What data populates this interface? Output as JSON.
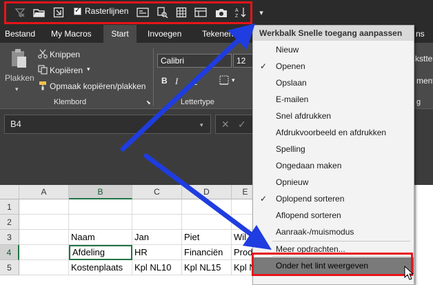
{
  "qat": {
    "rasterlijnen_label": "Rasterlijnen",
    "more_glyph": "▾",
    "icons": [
      "clear-filter-icon",
      "open-folder-icon",
      "grid-icon",
      "rasterlijnen-checkbox",
      "form-icon",
      "print-preview-icon",
      "table-icon",
      "table2-icon",
      "camera-icon",
      "sort-az-icon",
      "customize-icon"
    ]
  },
  "tabs": [
    "Bestand",
    "My Macros",
    "Start",
    "Invoegen",
    "Tekenen",
    "ns"
  ],
  "ribbon": {
    "paste_label": "Plakken",
    "cut_label": "Knippen",
    "copy_label": "Kopiëren",
    "format_painter_label": "Opmaak kopiëren/plakken",
    "clipboard_group": "Klembord",
    "font_name": "Calibri",
    "font_size": "12",
    "font_group": "Lettertype",
    "bold": "B",
    "italic": "I",
    "right_cut_1": "ksttер",
    "right_cut_2": "menv",
    "right_cut_3": "g"
  },
  "namebox": {
    "value": "B4"
  },
  "grid": {
    "columns": [
      "A",
      "B",
      "C",
      "D",
      "E"
    ],
    "rows": [
      "1",
      "2",
      "3",
      "4",
      "5"
    ],
    "cells": {
      "B3": "Naam",
      "C3": "Jan",
      "D3": "Piet",
      "E3": "Wil",
      "B4": "Afdeling",
      "C4": "HR",
      "D4": "Financiën",
      "E4": "Prod",
      "B5": "Kostenplaats",
      "C5": "Kpl NL10",
      "D5": "Kpl NL15",
      "E5": "Kpl N"
    }
  },
  "menu": {
    "title": "Werkbalk Snelle toegang aanpassen",
    "items": [
      {
        "label": "Nieuw",
        "checked": false
      },
      {
        "label": "Openen",
        "checked": true
      },
      {
        "label": "Opslaan",
        "checked": false
      },
      {
        "label": "E-mailen",
        "checked": false
      },
      {
        "label": "Snel afdrukken",
        "checked": false
      },
      {
        "label": "Afdrukvoorbeeld en afdrukken",
        "checked": false
      },
      {
        "label": "Spelling",
        "checked": false
      },
      {
        "label": "Ongedaan maken",
        "checked": false
      },
      {
        "label": "Opnieuw",
        "checked": false
      },
      {
        "label": "Oplopend sorteren",
        "checked": true
      },
      {
        "label": "Aflopend sorteren",
        "checked": false
      },
      {
        "label": "Aanraak-/muismodus",
        "checked": false
      },
      {
        "label": "Meer opdrachten...",
        "checked": false
      },
      {
        "label": "Onder het lint weergeven",
        "checked": false
      }
    ],
    "check_glyph": "✓"
  },
  "colors": {
    "highlight_box": "#e8141a",
    "arrow": "#1f3de0",
    "selection": "#217346"
  }
}
